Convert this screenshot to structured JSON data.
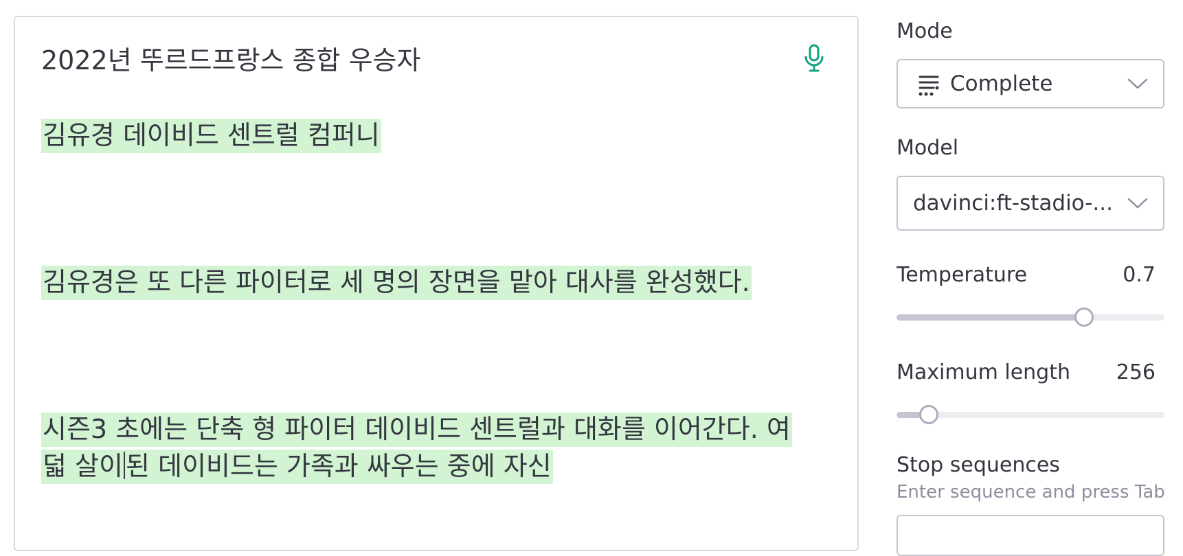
{
  "editor": {
    "prompt": "2022년 뚜르드프랑스 종합 우승자",
    "generated": [
      "김유경 데이비드 센트럴 컴퍼니",
      "김유경은 또 다른 파이터로 세 명의 장면을 맡아 대사를 완성했다.",
      "시즌3 초에는 단축 형 파이터 데이비드 센트럴과 대화를 이어간다. 여",
      "덟 살이",
      "된 데이비드는 가족과 싸우는 중에 자신"
    ],
    "mic_icon": "microphone-icon"
  },
  "sidebar": {
    "mode": {
      "label": "Mode",
      "value": "Complete",
      "icon": "complete-mode-icon"
    },
    "model": {
      "label": "Model",
      "value": "davinci:ft-stadio-..."
    },
    "temperature": {
      "label": "Temperature",
      "value": "0.7",
      "fraction": 0.7
    },
    "max_length": {
      "label": "Maximum length",
      "value": "256",
      "fraction": 0.12
    },
    "stop_sequences": {
      "label": "Stop sequences",
      "hint": "Enter sequence and press Tab"
    }
  },
  "colors": {
    "highlight": "#d2f4d3",
    "accent": "#10a37f",
    "border": "#c5c5d2"
  }
}
